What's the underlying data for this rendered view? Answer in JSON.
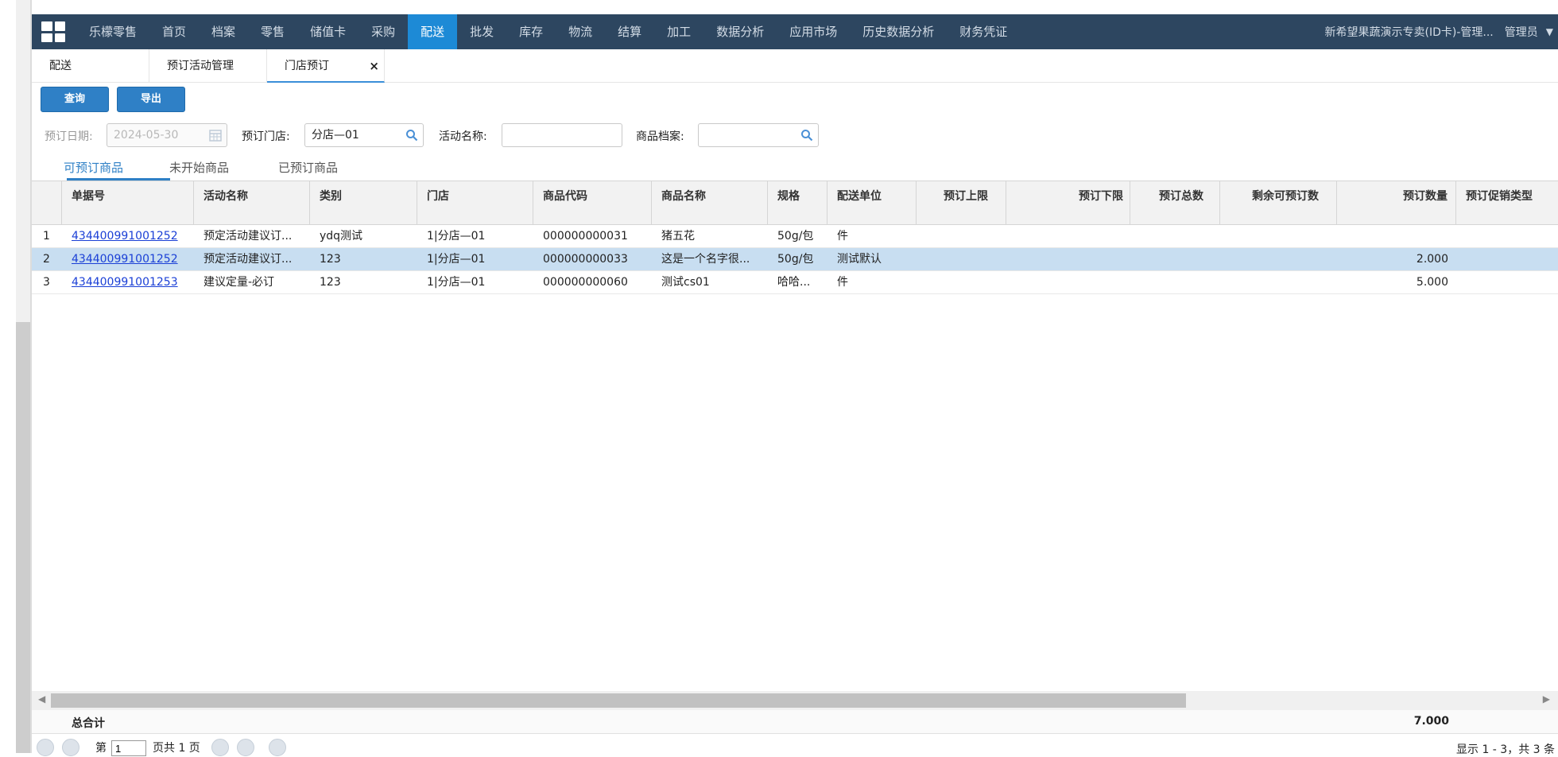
{
  "nav": {
    "items": [
      {
        "label": "乐檬零售",
        "active": false
      },
      {
        "label": "首页",
        "active": false
      },
      {
        "label": "档案",
        "active": false
      },
      {
        "label": "零售",
        "active": false
      },
      {
        "label": "储值卡",
        "active": false
      },
      {
        "label": "采购",
        "active": false
      },
      {
        "label": "配送",
        "active": true
      },
      {
        "label": "批发",
        "active": false
      },
      {
        "label": "库存",
        "active": false
      },
      {
        "label": "物流",
        "active": false
      },
      {
        "label": "结算",
        "active": false
      },
      {
        "label": "加工",
        "active": false
      },
      {
        "label": "数据分析",
        "active": false
      },
      {
        "label": "应用市场",
        "active": false
      },
      {
        "label": "历史数据分析",
        "active": false
      },
      {
        "label": "财务凭证",
        "active": false
      }
    ],
    "company": "新希望果蔬演示专卖(ID卡)-管理...",
    "user": "管理员",
    "accent": "#1d8ad6",
    "bar_color": "#2d4660"
  },
  "tabs": [
    {
      "label": "配送"
    },
    {
      "label": "预订活动管理"
    },
    {
      "label": "门店预订",
      "close": "×"
    }
  ],
  "toolbar": {
    "query_label": "查询",
    "export_label": "导出"
  },
  "filters": {
    "date_label": "预订日期:",
    "date_value": "2024-05-30",
    "store_label": "预订门店:",
    "store_value": "分店—01",
    "activity_label": "活动名称:",
    "activity_value": "",
    "product_label": "商品档案:",
    "product_value": ""
  },
  "subtabs": [
    {
      "label": "可预订商品",
      "active": true
    },
    {
      "label": "未开始商品",
      "active": false
    },
    {
      "label": "已预订商品",
      "active": false
    }
  ],
  "table": {
    "columns": [
      "单据号",
      "活动名称",
      "类别",
      "门店",
      "商品代码",
      "商品名称",
      "规格",
      "配送单位",
      "预订上限",
      "预订下限",
      "预订总数",
      "剩余可预订数",
      "预订数量",
      "预订促销类型"
    ],
    "rows": [
      {
        "idx": "1",
        "doc": "434400991001252",
        "activity": "预定活动建议订...",
        "category": "ydq测试",
        "store": "1|分店—01",
        "code": "000000000031",
        "name": "猪五花",
        "spec": "50g/包",
        "unit": "件",
        "qty": "",
        "selected": false
      },
      {
        "idx": "2",
        "doc": "434400991001252",
        "activity": "预定活动建议订...",
        "category": "123",
        "store": "1|分店—01",
        "code": "000000000033",
        "name": "这是一个名字很...",
        "spec": "50g/包",
        "unit": "测试默认",
        "qty": "2.000",
        "selected": true
      },
      {
        "idx": "3",
        "doc": "434400991001253",
        "activity": "建议定量-必订",
        "category": "123",
        "store": "1|分店—01",
        "code": "000000000060",
        "name": "测试cs01",
        "spec": "哈哈...",
        "unit": "件",
        "qty": "5.000",
        "selected": false
      }
    ]
  },
  "totals": {
    "label": "总合计",
    "qty": "7.000"
  },
  "pager": {
    "prefix": "第",
    "page": "1",
    "suffix": "页共 1 页",
    "summary": "显示 1 - 3，共 3 条"
  }
}
